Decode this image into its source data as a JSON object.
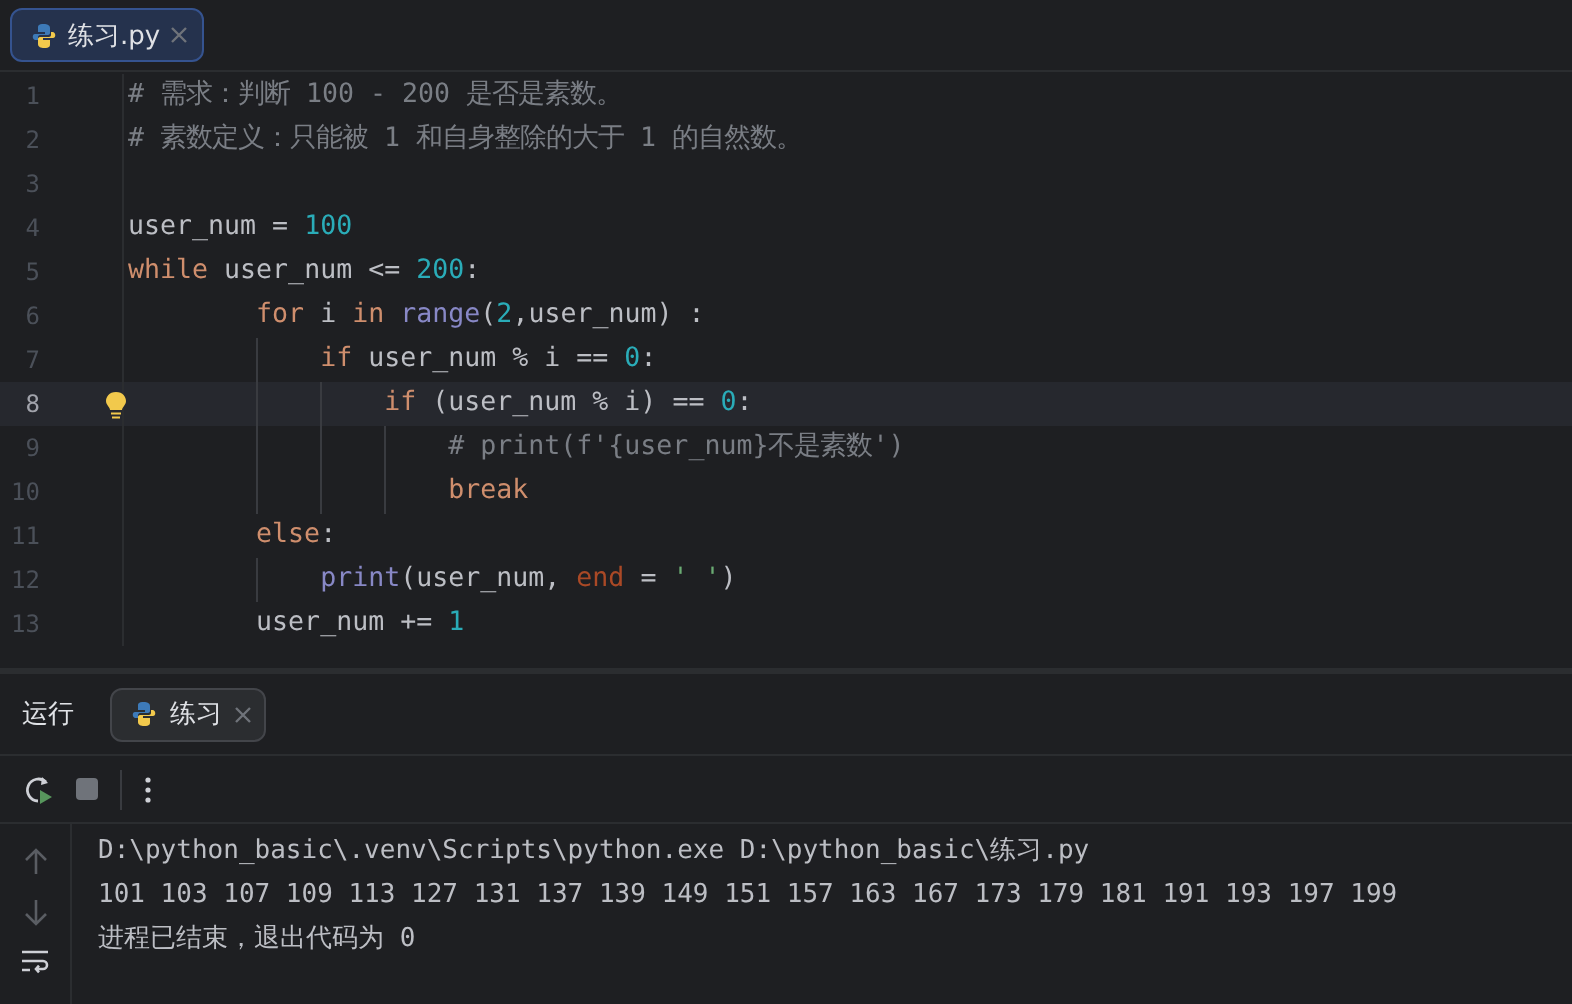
{
  "editor_tabs": [
    {
      "label": "练习.py",
      "selected": true
    }
  ],
  "code_lines": [
    {
      "number": "1",
      "current": false,
      "bulb": false,
      "tokens": [
        {
          "kind": "comment",
          "text": "# 需求：判断 100 - 200 是否是素数。"
        }
      ]
    },
    {
      "number": "2",
      "current": false,
      "bulb": false,
      "tokens": [
        {
          "kind": "comment",
          "text": "# 素数定义：只能被 1 和自身整除的大于 1 的自然数。"
        }
      ]
    },
    {
      "number": "3",
      "current": false,
      "bulb": false
    },
    {
      "number": "4",
      "current": false,
      "bulb": false,
      "tokens": [
        {
          "kind": "plain",
          "text": "user_num = "
        },
        {
          "kind": "number",
          "text": "100"
        }
      ]
    },
    {
      "number": "5",
      "current": false,
      "bulb": false,
      "tokens": [
        {
          "kind": "keyword",
          "text": "while"
        },
        {
          "kind": "plain",
          "text": " user_num <= "
        },
        {
          "kind": "number",
          "text": "200"
        },
        {
          "kind": "plain",
          "text": ":"
        }
      ]
    },
    {
      "number": "6",
      "current": false,
      "bulb": false,
      "tokens": [
        {
          "kind": "keyword",
          "text": "        for"
        },
        {
          "kind": "plain",
          "text": " i "
        },
        {
          "kind": "keyword",
          "text": "in "
        },
        {
          "kind": "builtin",
          "text": "range"
        },
        {
          "kind": "plain",
          "text": "("
        },
        {
          "kind": "number",
          "text": "2"
        },
        {
          "kind": "plain",
          "text": ",user_num) :"
        }
      ]
    },
    {
      "number": "7",
      "current": false,
      "bulb": false,
      "tokens": [
        {
          "kind": "keyword",
          "text": "            if"
        },
        {
          "kind": "plain",
          "text": " user_num % i == "
        },
        {
          "kind": "number",
          "text": "0"
        },
        {
          "kind": "plain",
          "text": ":"
        }
      ]
    },
    {
      "number": "8",
      "current": true,
      "bulb": true,
      "tokens": [
        {
          "kind": "keyword",
          "text": "                if"
        },
        {
          "kind": "plain",
          "text": " (user_num % i) == "
        },
        {
          "kind": "number",
          "text": "0"
        },
        {
          "kind": "plain",
          "text": ":"
        }
      ]
    },
    {
      "number": "9",
      "current": false,
      "bulb": false,
      "tokens": [
        {
          "kind": "comment",
          "text": "                    # print(f'{user_num}不是素数')"
        }
      ]
    },
    {
      "number": "10",
      "current": false,
      "bulb": false,
      "tokens": [
        {
          "kind": "keyword",
          "text": "                    break"
        }
      ]
    },
    {
      "number": "11",
      "current": false,
      "bulb": false,
      "tokens": [
        {
          "kind": "keyword",
          "text": "        else"
        },
        {
          "kind": "plain",
          "text": ":"
        }
      ]
    },
    {
      "number": "12",
      "current": false,
      "bulb": false,
      "tokens": [
        {
          "kind": "builtin",
          "text": "            print"
        },
        {
          "kind": "plain",
          "text": "(user_num, "
        },
        {
          "kind": "param",
          "text": "end"
        },
        {
          "kind": "plain",
          "text": " = "
        },
        {
          "kind": "string",
          "text": "' '"
        },
        {
          "kind": "plain",
          "text": ")"
        }
      ]
    },
    {
      "number": "13",
      "current": false,
      "bulb": false,
      "tokens": [
        {
          "kind": "plain",
          "text": "        user_num += "
        },
        {
          "kind": "number",
          "text": "1"
        }
      ]
    }
  ],
  "run_panel": {
    "title": "运行",
    "tabs": [
      {
        "label": "练习",
        "selected": true
      }
    ],
    "output": [
      "D:\\python_basic\\.venv\\Scripts\\python.exe D:\\python_basic\\练习.py",
      "101 103 107 109 113 127 131 137 139 149 151 157 163 167 173 179 181 191 193 197 199",
      "进程已结束，退出代码为 0"
    ]
  }
}
